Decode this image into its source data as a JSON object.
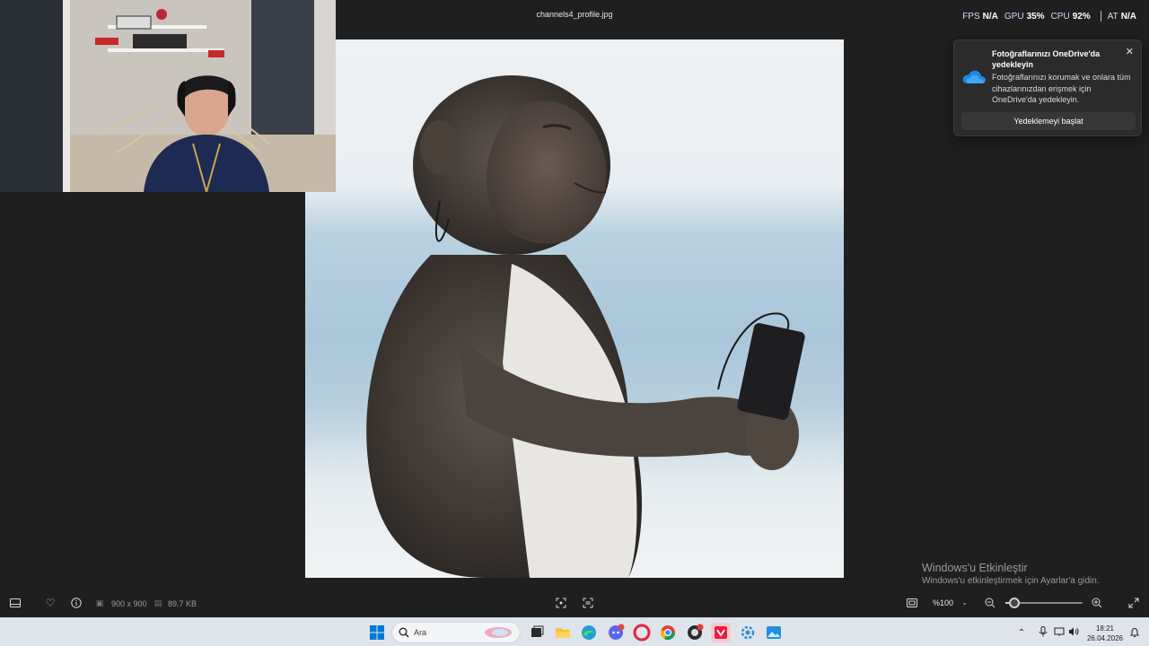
{
  "window": {
    "file_name": "channels4_profile.jpg"
  },
  "perf_overlay": {
    "fps_label": "FPS",
    "fps_value": "N/A",
    "gpu_label": "GPU",
    "gpu_value": "35%",
    "cpu_label": "CPU",
    "cpu_value": "92%",
    "third_label": "AT",
    "third_value": "N/A"
  },
  "toast": {
    "title": "Fotoğraflarınızı OneDrive'da yedekleyin",
    "body": "Fotoğraflarınızı korumak ve onlara tüm cihazlarınızdan erişmek için OneDrive'da yedekleyin.",
    "button_label": "Yedeklemeyi başlat",
    "icon": "onedrive-cloud-icon"
  },
  "watermark": {
    "line1": "Windows'u Etkinleştir",
    "line2": "Windows'u etkinleştirmek için Ayarlar'a gidin."
  },
  "viewer_toolbar": {
    "dimensions": "900 x 900",
    "file_size": "89.7 KB",
    "zoom_value": "%100",
    "zoom_fraction": 0.12
  },
  "taskbar": {
    "search_placeholder": "Ara",
    "clock_time": "18:21",
    "clock_date": "26.04.2026"
  },
  "colors": {
    "viewer_bg": "#1f1f1f",
    "toast_bg": "#2b2b2b",
    "taskbar_bg": "#dfe4ea",
    "accent_blue": "#0f6cbd"
  }
}
